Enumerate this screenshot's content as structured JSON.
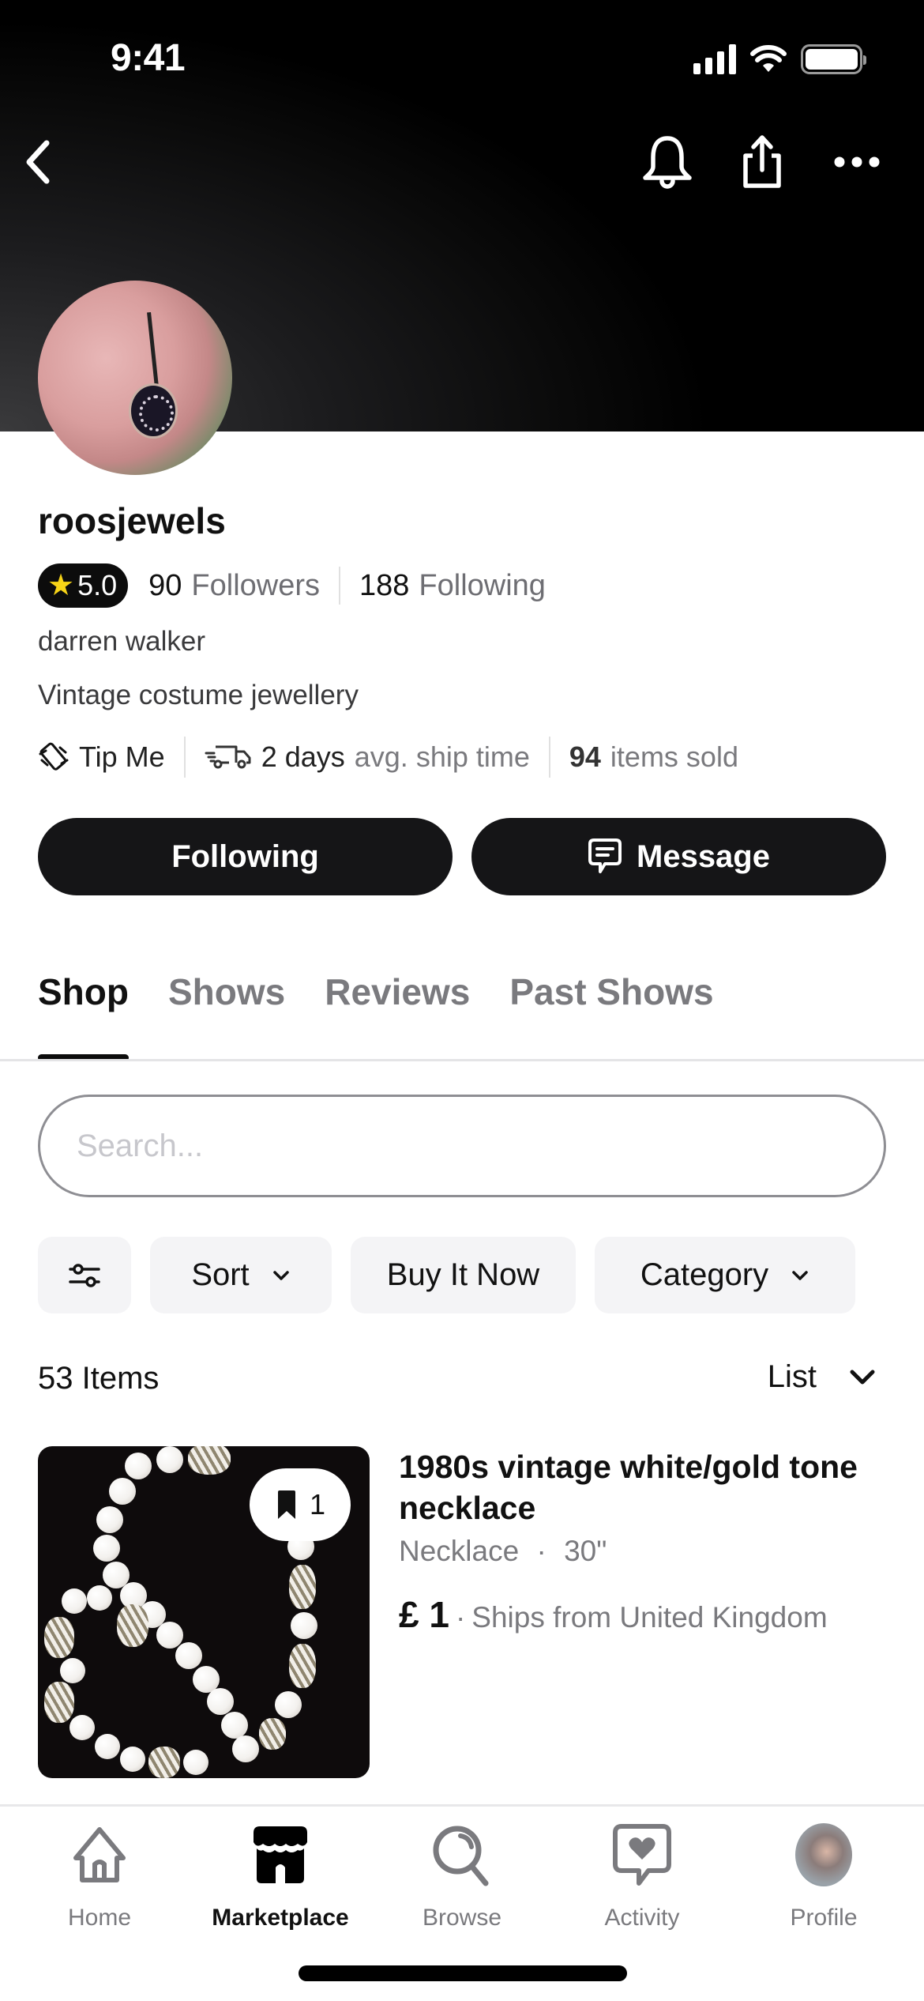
{
  "status_bar": {
    "time": "9:41"
  },
  "header": {
    "back_icon": "chevron-left-icon",
    "actions": [
      "bell-icon",
      "share-icon",
      "more-horizontal-icon"
    ]
  },
  "profile": {
    "username": "roosjewels",
    "rating": "5.0",
    "followers_count": "90",
    "followers_label": "Followers",
    "following_count": "188",
    "following_label": "Following",
    "real_name": "darren walker",
    "bio": "Vintage costume jewellery",
    "tip_label": "Tip Me",
    "ship_time_value": "2 days",
    "ship_time_label": "avg. ship time",
    "items_sold_count": "94",
    "items_sold_label": "items sold"
  },
  "actions": {
    "following_label": "Following",
    "message_label": "Message"
  },
  "tabs": [
    {
      "label": "Shop",
      "active": true
    },
    {
      "label": "Shows",
      "active": false
    },
    {
      "label": "Reviews",
      "active": false
    },
    {
      "label": "Past Shows",
      "active": false
    }
  ],
  "search": {
    "placeholder": "Search...",
    "value": ""
  },
  "filters": {
    "filter_icon": "sliders-icon",
    "sort_label": "Sort",
    "buy_it_now_label": "Buy It Now",
    "category_label": "Category"
  },
  "listing": {
    "count_label": "53 Items",
    "view_mode": "List"
  },
  "products": [
    {
      "title": "1980s vintage white/gold tone necklace",
      "category": "Necklace",
      "size": "30\"",
      "separator": "·",
      "price": "£ 1",
      "ships_from": "Ships from United Kingdom",
      "saves": "1"
    }
  ],
  "tab_bar": [
    {
      "label": "Home",
      "icon": "home-icon",
      "active": false
    },
    {
      "label": "Marketplace",
      "icon": "storefront-icon",
      "active": true
    },
    {
      "label": "Browse",
      "icon": "search-icon",
      "active": false
    },
    {
      "label": "Activity",
      "icon": "heart-message-icon",
      "active": false
    },
    {
      "label": "Profile",
      "icon": "profile-avatar",
      "active": false
    }
  ],
  "colors": {
    "header_bg": "#000000",
    "button_bg": "#151517",
    "star": "#f7d417",
    "muted_text": "#7a7a7e",
    "chip_bg": "#f4f4f6"
  }
}
